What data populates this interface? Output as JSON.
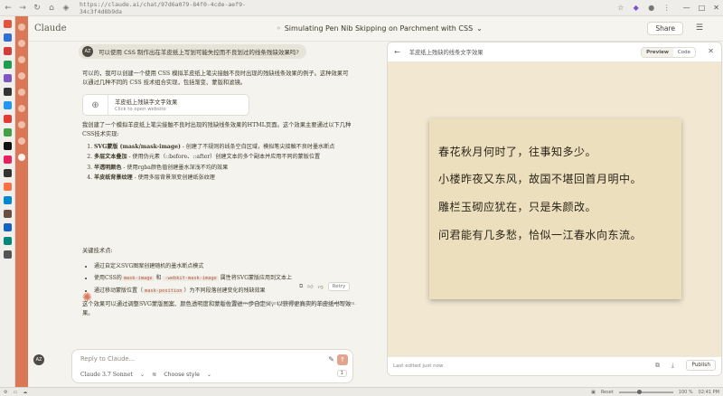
{
  "browser": {
    "url": "https://claude.ai/chat/97d6a079-84f0-4cde-aef9-34c3f4d8b9da",
    "icons": [
      "back-icon",
      "forward-icon",
      "reload-icon",
      "home-icon",
      "shield-icon",
      "star-icon",
      "extension-icon",
      "profile-icon",
      "menu-icon"
    ]
  },
  "header": {
    "brand": "Claude",
    "title": "Simulating Pen Nib Skipping on Parchment with CSS",
    "share_label": "Share"
  },
  "chat": {
    "user_initials": "AZ",
    "user_message": "可以使用 CSS 制作出在羊皮纸上写划可能失控而不良划过的线条残缺效果吗?",
    "intro": "可以的，我可以创建一个使用 CSS 模拟羊皮纸上笔尖接触不良时出现的残缺线条效果的例子。这种效果可以通过几种不同的 CSS 技术组合实现，包括渐变、蒙版和滤镜。",
    "artifact": {
      "title": "羊皮纸上残缺字文字效果",
      "subtitle": "Click to open website"
    },
    "summary": "我创建了一个模拟羊皮纸上笔尖接触不良时出现的残缺线条效果的HTML页面。这个效果主要通过以下几种CSS技术实现:",
    "features": [
      {
        "title": "SVG蒙版 (mask/mask-image)",
        "text": " - 创建了不规则的线条空白区域，模拟笔尖接触不良时墨水断点"
      },
      {
        "title": "多层文本叠加",
        "text": " - 使用伪元素（::before、::after）创建文本的多个副本并应用不同的蒙版位置"
      },
      {
        "title": "半透明颜色",
        "text": " - 使用rgba颜色值创建墨水深浅不均的效果"
      },
      {
        "title": "羊皮纸背景纹理",
        "text": " - 使用多层背景渐变创建纸张纹理"
      }
    ],
    "tech_heading": "关键技术点:",
    "tech_points": [
      {
        "pre": "通过自定义SVG图案创建随机的墨水断点模式",
        "code": "",
        "post": ""
      },
      {
        "pre": "使用CSS的",
        "code": "mask-image",
        "mid": " 和 ",
        "code2": "-webkit-mask-image",
        "post": " 属性将SVG蒙版应用到文本上"
      },
      {
        "pre": "通过移动蒙版位置（",
        "code": "mask-position",
        "post": "）为不同段落创建变化的残缺效果"
      }
    ],
    "closing": "这个效果可以通过调整SVG蒙版图案、颜色透明度和蒙版位置进一步自定义，以获得更真实的羊皮纸书写效果。",
    "retry_label": "Retry",
    "disclaimer": "Claude can make mistakes. Please double-check responses.",
    "input_placeholder": "Reply to Claude...",
    "model_label": "Claude 3.7 Sonnet",
    "style_label": "Choose style",
    "attach_count": "1"
  },
  "panel": {
    "title": "羊皮纸上残缺的线条文字效果",
    "preview_label": "Preview",
    "code_label": "Code",
    "poem": [
      "春花秋月何时了，往事知多少。",
      "小楼昨夜又东风，故国不堪回首月明中。",
      "雕栏玉砌应犹在，只是朱颜改。",
      "问君能有几多愁，恰似一江春水向东流。"
    ],
    "edited_label": "Last edited just now",
    "publish_label": "Publish"
  },
  "taskbar": {
    "reset_label": "Reset",
    "zoom": "100 %",
    "time": "02:41 PM"
  },
  "colors": {
    "accent": "#d97757",
    "parchment": "#ecdfbe",
    "preview_bg": "#f2e8d2"
  }
}
